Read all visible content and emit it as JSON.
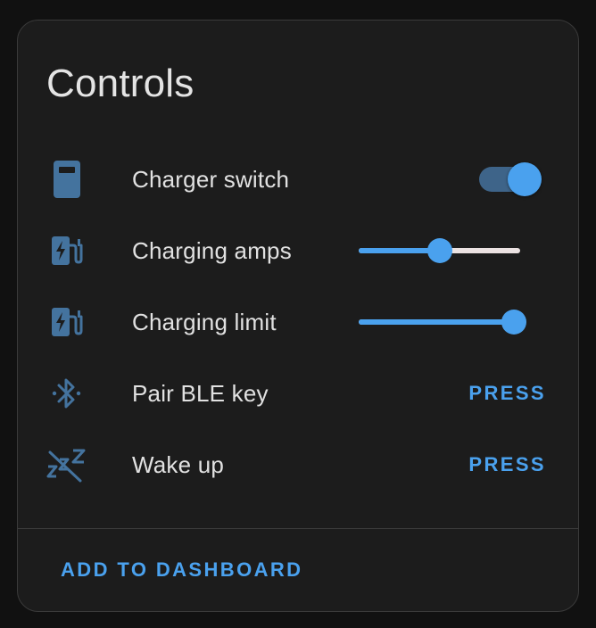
{
  "card": {
    "title": "Controls",
    "footer_button": "ADD TO DASHBOARD"
  },
  "colors": {
    "accent": "#4aa1ee",
    "icon": "#44739e",
    "background": "#1c1c1c"
  },
  "controls": [
    {
      "label": "Charger switch",
      "icon": "ev-charger-icon",
      "type": "toggle",
      "state": "on"
    },
    {
      "label": "Charging amps",
      "icon": "ev-station-icon",
      "type": "slider",
      "level": 0.5
    },
    {
      "label": "Charging limit",
      "icon": "ev-station-icon",
      "type": "slider",
      "level": 0.96
    },
    {
      "label": "Pair BLE key",
      "icon": "bluetooth-icon",
      "type": "button",
      "button_label": "PRESS"
    },
    {
      "label": "Wake up",
      "icon": "sleep-off-icon",
      "type": "button",
      "button_label": "PRESS"
    }
  ]
}
